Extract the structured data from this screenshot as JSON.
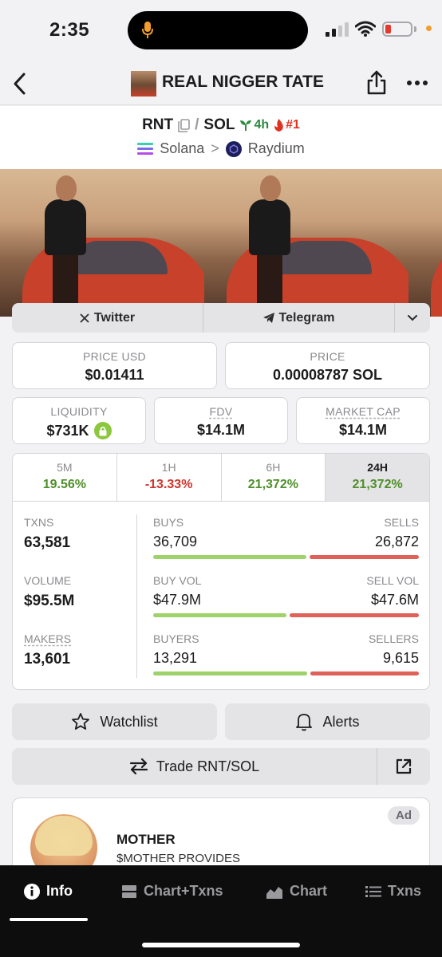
{
  "status": {
    "time": "2:35"
  },
  "header": {
    "title": "REAL NIGGER TATE"
  },
  "pair": {
    "base": "RNT",
    "separator": "/",
    "quote": "SOL",
    "age": "4h",
    "rank": "#1",
    "chain": "Solana",
    "chevron": ">",
    "dex": "Raydium"
  },
  "links": {
    "twitter": "Twitter",
    "telegram": "Telegram"
  },
  "stats": {
    "price_usd_label": "PRICE USD",
    "price_usd": "$0.01411",
    "price_label": "PRICE",
    "price": "0.00008787 SOL",
    "liquidity_label": "LIQUIDITY",
    "liquidity": "$731K",
    "fdv_label": "FDV",
    "fdv": "$14.1M",
    "mcap_label": "MARKET CAP",
    "mcap": "$14.1M"
  },
  "timeframes": [
    {
      "label": "5M",
      "change": "19.56%",
      "trend": "up"
    },
    {
      "label": "1H",
      "change": "-13.33%",
      "trend": "down"
    },
    {
      "label": "6H",
      "change": "21,372%",
      "trend": "up"
    },
    {
      "label": "24H",
      "change": "21,372%",
      "trend": "up",
      "selected": true
    }
  ],
  "txn_stats": {
    "txns_label": "TXNS",
    "txns": "63,581",
    "volume_label": "VOLUME",
    "volume": "$95.5M",
    "makers_label": "MAKERS",
    "makers": "13,601",
    "buys_label": "BUYS",
    "buys": "36,709",
    "sells_label": "SELLS",
    "sells": "26,872",
    "buy_ratio": 0.577,
    "buy_vol_label": "BUY VOL",
    "buy_vol": "$47.9M",
    "sell_vol_label": "SELL VOL",
    "sell_vol": "$47.6M",
    "buy_vol_ratio": 0.502,
    "buyers_label": "BUYERS",
    "buyers": "13,291",
    "sellers_label": "SELLERS",
    "sellers": "9,615",
    "buyer_ratio": 0.58
  },
  "actions": {
    "watchlist": "Watchlist",
    "alerts": "Alerts",
    "trade": "Trade RNT/SOL"
  },
  "ad": {
    "badge": "Ad",
    "name": "MOTHER",
    "description": "$MOTHER PROVIDES"
  },
  "bottom_nav": [
    {
      "label": "Info",
      "icon": "info-icon",
      "active": true
    },
    {
      "label": "Chart+Txns",
      "icon": "split-view-icon"
    },
    {
      "label": "Chart",
      "icon": "area-chart-icon"
    },
    {
      "label": "Txns",
      "icon": "list-icon"
    }
  ],
  "colors": {
    "positive": "#4f8f2a",
    "negative": "#d0342c",
    "buy_bar": "#9fd26a",
    "sell_bar": "#e0605a",
    "liquidity_lock": "#8cc83e"
  }
}
